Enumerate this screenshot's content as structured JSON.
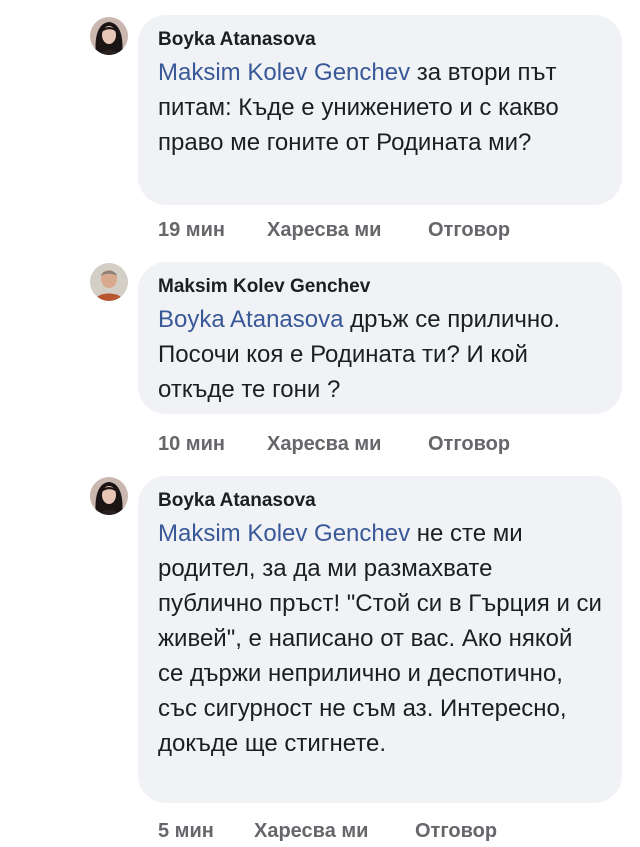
{
  "comments": [
    {
      "author": "Boyka Atanasova",
      "mention": "Maksim Kolev Genchev",
      "text": " за втори път питам: Къде е унижението и с какво право ме гоните от Родината ми?",
      "time": "19 мин",
      "like_label": "Харесва ми",
      "reply_label": "Отговор",
      "avatar": "woman-avatar"
    },
    {
      "author": "Maksim Kolev Genchev",
      "mention": "Boyka Atanasova",
      "text": " дръж се прилично. Посочи коя е Родината ти? И кой откъде те гони ?",
      "time": "10 мин",
      "like_label": "Харесва ми",
      "reply_label": "Отговор",
      "avatar": "man-avatar"
    },
    {
      "author": "Boyka Atanasova",
      "mention": "Maksim Kolev Genchev",
      "text": " не сте ми родител, за да ми размахвате публично пръст! \"Стой си в Гърция и си живей\", е написано от вас. Ако някой се държи неприлично и деспотично, със сигурност не съм аз. Интересно, докъде ще стигнете.",
      "time": "5 мин",
      "like_label": "Харесва ми",
      "reply_label": "Отговор",
      "avatar": "woman-avatar"
    }
  ],
  "colors": {
    "bubble_bg": "#f0f2f5",
    "mention": "#385898",
    "meta": "#65676b",
    "text": "#1c1e21"
  }
}
